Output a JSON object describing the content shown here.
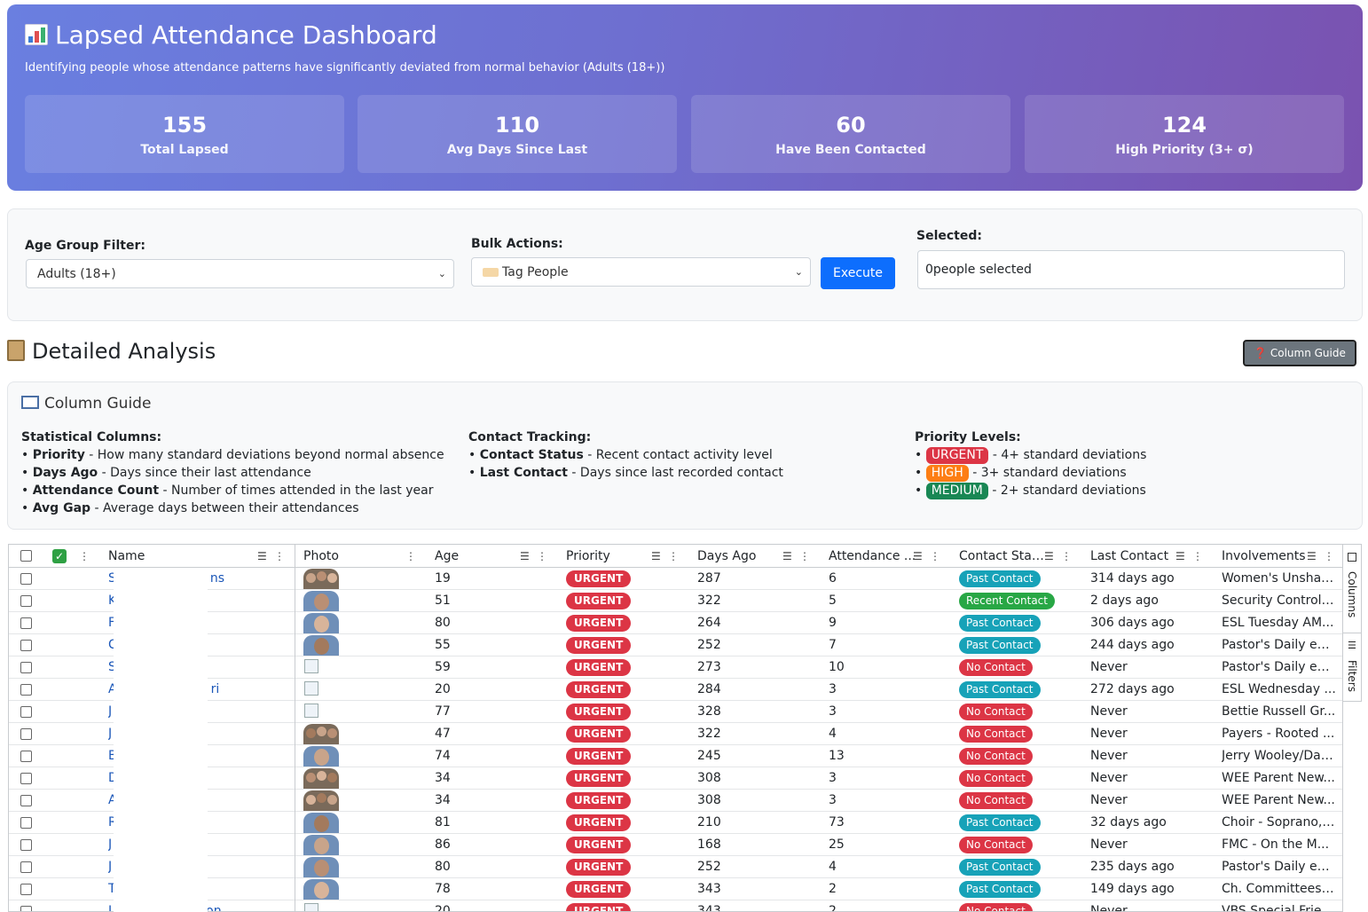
{
  "header": {
    "title": "Lapsed Attendance Dashboard",
    "subtitle": "Identifying people whose attendance patterns have significantly deviated from normal behavior (Adults (18+))",
    "stats": [
      {
        "value": "155",
        "label": "Total Lapsed"
      },
      {
        "value": "110",
        "label": "Avg Days Since Last"
      },
      {
        "value": "60",
        "label": "Have Been Contacted"
      },
      {
        "value": "124",
        "label": "High Priority (3+ σ)"
      }
    ]
  },
  "controls": {
    "age_label": "Age Group Filter:",
    "age_value": "Adults (18+)",
    "bulk_label": "Bulk Actions:",
    "bulk_value": "Tag People",
    "execute_label": "Execute",
    "selected_label": "Selected:",
    "selected_value": "0people selected"
  },
  "section": {
    "title": "Detailed Analysis",
    "guide_button": "❓ Column Guide"
  },
  "guide": {
    "title": "Column Guide",
    "stat_head": "Statistical Columns:",
    "stat_items": [
      {
        "term": "Priority",
        "desc": " - How many standard deviations beyond normal absence"
      },
      {
        "term": "Days Ago",
        "desc": " - Days since their last attendance"
      },
      {
        "term": "Attendance Count",
        "desc": " - Number of times attended in the last year"
      },
      {
        "term": "Avg Gap",
        "desc": " - Average days between their attendances"
      }
    ],
    "contact_head": "Contact Tracking:",
    "contact_items": [
      {
        "term": "Contact Status",
        "desc": " - Recent contact activity level"
      },
      {
        "term": "Last Contact",
        "desc": " - Days since last recorded contact"
      }
    ],
    "priority_head": "Priority Levels:",
    "priority_items": [
      {
        "badge": "URGENT",
        "color": "#dc3545",
        "desc": " - 4+ standard deviations"
      },
      {
        "badge": "HIGH",
        "color": "#fd7e14",
        "desc": " - 3+ standard deviations"
      },
      {
        "badge": "MEDIUM",
        "color": "#198754",
        "desc": " - 2+ standard deviations"
      }
    ]
  },
  "grid": {
    "columns": [
      "Name",
      "Photo",
      "Age",
      "Priority",
      "Days Ago",
      "Attendance ...",
      "Contact Stat...",
      "Last Contact",
      "Involvements"
    ],
    "status_colors": {
      "Past Contact": "#17a2b8",
      "Recent Contact": "#28a745",
      "No Contact": "#dc3545"
    },
    "rows": [
      {
        "name": "S",
        "name_tail": "ns",
        "photo": "group",
        "age": "19",
        "priority": "URGENT",
        "days": "287",
        "attendance": "6",
        "status": "Past Contact",
        "last": "314 days ago",
        "inv": "Women's Unshak..."
      },
      {
        "name": "K",
        "name_tail": "",
        "photo": "person",
        "age": "51",
        "priority": "URGENT",
        "days": "322",
        "attendance": "5",
        "status": "Recent Contact",
        "last": "2 days ago",
        "inv": "Security Control ..."
      },
      {
        "name": "F",
        "name_tail": "",
        "photo": "person",
        "age": "80",
        "priority": "URGENT",
        "days": "264",
        "attendance": "9",
        "status": "Past Contact",
        "last": "306 days ago",
        "inv": "ESL Tuesday AM..."
      },
      {
        "name": "C",
        "name_tail": "",
        "photo": "person",
        "age": "55",
        "priority": "URGENT",
        "days": "252",
        "attendance": "7",
        "status": "Past Contact",
        "last": "244 days ago",
        "inv": "Pastor's Daily eC..."
      },
      {
        "name": "S",
        "name_tail": "",
        "photo": "broken",
        "age": "59",
        "priority": "URGENT",
        "days": "273",
        "attendance": "10",
        "status": "No Contact",
        "last": "Never",
        "inv": "Pastor's Daily eC..."
      },
      {
        "name": "A",
        "name_tail": "ri",
        "photo": "broken",
        "age": "20",
        "priority": "URGENT",
        "days": "284",
        "attendance": "3",
        "status": "Past Contact",
        "last": "272 days ago",
        "inv": "ESL Wednesday ..."
      },
      {
        "name": "J",
        "name_tail": "",
        "photo": "broken",
        "age": "77",
        "priority": "URGENT",
        "days": "328",
        "attendance": "3",
        "status": "No Contact",
        "last": "Never",
        "inv": "Bettie Russell Gr..."
      },
      {
        "name": "J",
        "name_tail": "",
        "photo": "group",
        "age": "47",
        "priority": "URGENT",
        "days": "322",
        "attendance": "4",
        "status": "No Contact",
        "last": "Never",
        "inv": "Payers - Rooted ..."
      },
      {
        "name": "B",
        "name_tail": "",
        "photo": "person",
        "age": "74",
        "priority": "URGENT",
        "days": "245",
        "attendance": "13",
        "status": "No Contact",
        "last": "Never",
        "inv": "Jerry Wooley/Dav..."
      },
      {
        "name": "D",
        "name_tail": "",
        "photo": "group",
        "age": "34",
        "priority": "URGENT",
        "days": "308",
        "attendance": "3",
        "status": "No Contact",
        "last": "Never",
        "inv": "WEE Parent New..."
      },
      {
        "name": "A",
        "name_tail": "",
        "photo": "group",
        "age": "34",
        "priority": "URGENT",
        "days": "308",
        "attendance": "3",
        "status": "No Contact",
        "last": "Never",
        "inv": "WEE Parent New..."
      },
      {
        "name": "R",
        "name_tail": "",
        "photo": "person",
        "age": "81",
        "priority": "URGENT",
        "days": "210",
        "attendance": "73",
        "status": "Past Contact",
        "last": "32 days ago",
        "inv": "Choir - Soprano, ..."
      },
      {
        "name": "J",
        "name_tail": "",
        "photo": "person",
        "age": "86",
        "priority": "URGENT",
        "days": "168",
        "attendance": "25",
        "status": "No Contact",
        "last": "Never",
        "inv": "FMC - On the M..."
      },
      {
        "name": "J",
        "name_tail": "",
        "photo": "person",
        "age": "80",
        "priority": "URGENT",
        "days": "252",
        "attendance": "4",
        "status": "Past Contact",
        "last": "235 days ago",
        "inv": "Pastor's Daily eC..."
      },
      {
        "name": "T",
        "name_tail": "",
        "photo": "person",
        "age": "78",
        "priority": "URGENT",
        "days": "343",
        "attendance": "2",
        "status": "Past Contact",
        "last": "149 days ago",
        "inv": "Ch. Committees ,..."
      },
      {
        "name": "J",
        "name_tail": "on",
        "photo": "broken",
        "age": "20",
        "priority": "URGENT",
        "days": "343",
        "attendance": "2",
        "status": "No Contact",
        "last": "Never",
        "inv": "VBS Special Frie..."
      }
    ],
    "side_tabs": [
      "Columns",
      "Filters"
    ]
  }
}
